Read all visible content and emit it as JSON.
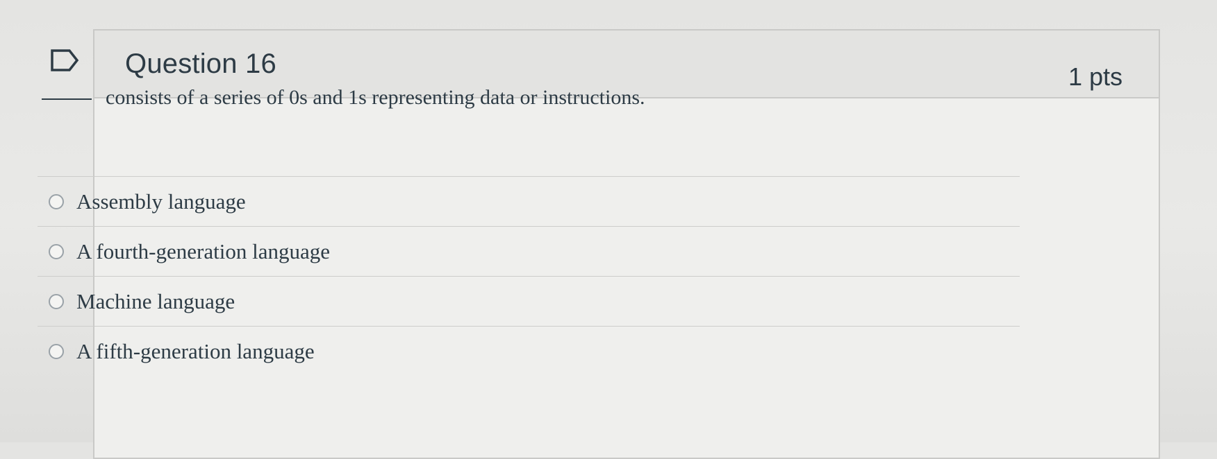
{
  "question": {
    "title": "Question 16",
    "points": "1 pts",
    "text": "consists of a series of 0s and 1s representing data or instructions.",
    "answers": [
      {
        "label": "Assembly language"
      },
      {
        "label": "A fourth-generation language"
      },
      {
        "label": "Machine language"
      },
      {
        "label": "A fifth-generation language"
      }
    ]
  },
  "icons": {
    "flag": "flag-outline-icon",
    "radio": "radio-unchecked-icon"
  },
  "colors": {
    "text": "#2d3b45",
    "header_bg": "#e3e3e1",
    "card_bg": "#efefed",
    "border": "#c9c9c7"
  }
}
